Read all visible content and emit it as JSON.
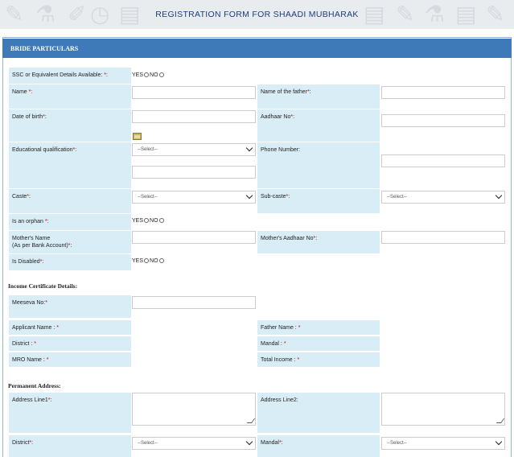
{
  "header": {
    "title": "REGISTRATION FORM FOR SHAADI MUBHARAK"
  },
  "section": {
    "title": "BRIDE PARTICULARS"
  },
  "fields": {
    "ssc_label": "SSC or Equivalent Details Available:",
    "name_label": "Name",
    "father_name_label": "Name of the father",
    "dob_label": "Date of birth",
    "aadhaar_label": "Aadhaar No",
    "edu_label": "Educational qualification",
    "phone_label": "Phone Number:",
    "caste_label": "Caste",
    "subcaste_label": "Sub-caste",
    "orphan_label": "Is an orphan",
    "mother_name_label_1": "Mother's Name",
    "mother_name_label_2": "(As per Bank Account)",
    "mother_aadhaar_label": "Mother's Aadhaar No",
    "disabled_label": "Is Disabled",
    "suffix_colon": ":",
    "req_mark": "*",
    "req_colon": "*:"
  },
  "radio": {
    "yes": "YES",
    "no": "NO"
  },
  "select_placeholder": "--Select--",
  "income": {
    "heading": "Income Certificate Details:",
    "meeseva_label": "Meeseva No:",
    "applicant_label": "Applicant Name :",
    "father_label": "Father Name :",
    "district_label": "District :",
    "mandal_label": "Mandal :",
    "mro_label": "MRO Name :",
    "total_income_label": "Total Income :"
  },
  "address": {
    "heading": "Permanent Address:",
    "line1_label": "Address Line1",
    "line2_label": "Address Line2:",
    "district_label": "District",
    "mandal_label": "Mandal"
  },
  "colors": {
    "label_bg": "#d9edf7",
    "section_bg": "#3f7ab8",
    "required": "#cc0000",
    "title": "#1b3f7a"
  }
}
